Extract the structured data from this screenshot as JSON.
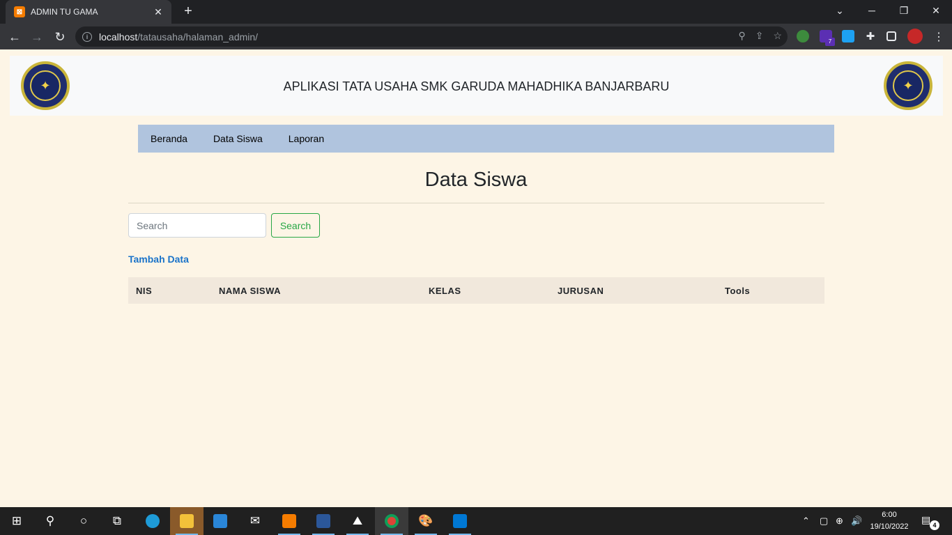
{
  "browser": {
    "tab_title": "ADMIN TU GAMA",
    "url_host": "localhost",
    "url_path": "/tatausaha/halaman_admin/",
    "extension_badge": "7"
  },
  "header": {
    "app_title": "APLIKASI TATA USAHA SMK GARUDA MAHADHIKA BANJARBARU"
  },
  "nav": {
    "items": [
      "Beranda",
      "Data Siswa",
      "Laporan"
    ]
  },
  "main": {
    "heading": "Data Siswa",
    "search_placeholder": "Search",
    "search_button": "Search",
    "add_link": "Tambah Data",
    "table_columns": [
      "NIS",
      "NAMA SISWA",
      "KELAS",
      "JURUSAN",
      "Tools"
    ]
  },
  "taskbar": {
    "time": "6:00",
    "date": "19/10/2022",
    "notification_count": "4"
  },
  "colors": {
    "page_bg": "#fdf5e6",
    "navbar_bg": "#b0c4de",
    "table_head_bg": "#f1e8dc",
    "success": "#28a745",
    "link": "#1a73c9"
  }
}
